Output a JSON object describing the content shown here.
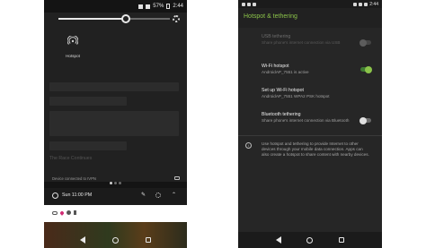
{
  "left_phone": {
    "status": {
      "battery": "57%",
      "time": "2:44"
    },
    "quick_settings": {
      "brightness": 0.6,
      "hotspot_label": "Hotspot"
    },
    "background_title": "The Race Continues",
    "vpn_text": "Device connected to IVPN",
    "alarm_text": "Sun 11:00 PM",
    "icons": [
      "gear-icon",
      "hotspot-icon",
      "key-icon",
      "alarm-clock-icon",
      "pencil-icon",
      "chevron-up-icon"
    ]
  },
  "right_phone": {
    "status": {
      "time": "2:44"
    },
    "title": "Hotspot & tethering",
    "items": [
      {
        "title": "USB tethering",
        "summary": "Share phone's internet connection via USB",
        "switch": "disabled"
      },
      {
        "title": "Wi-Fi hotspot",
        "summary": "AndroidAP_7551 is active",
        "switch": "on"
      },
      {
        "title": "Set up Wi-Fi hotspot",
        "summary": "AndroidAP_7551 WPA2 PSK hotspot",
        "switch": "none"
      },
      {
        "title": "Bluetooth tethering",
        "summary": "Share phone's internet connection via Bluetooth",
        "switch": "off"
      }
    ],
    "info_text": "Use hotspot and tethering to provide Internet to other devices through your mobile data connection. Apps can also create a hotspot to share content with nearby devices.",
    "colors": {
      "accent": "#8bc34a",
      "background": "#262626"
    }
  }
}
